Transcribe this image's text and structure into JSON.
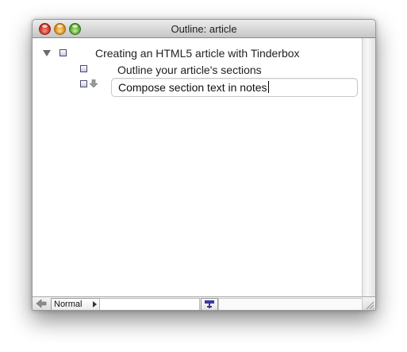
{
  "window": {
    "title": "Outline: article"
  },
  "outline": {
    "items": [
      {
        "label": "Creating an HTML5 article with Tinderbox",
        "level": 0,
        "expanded": true
      },
      {
        "label": "Outline your article's sections",
        "level": 1
      },
      {
        "label": "Compose section text in notes",
        "level": 1,
        "editing": true
      }
    ]
  },
  "statusbar": {
    "view_mode": "Normal"
  },
  "colors": {
    "close": "#c4261b",
    "minimize": "#d88a0f",
    "zoom": "#4c9d26",
    "note_icon": "#c9c9e6",
    "prototype_button": "#3a3a9a"
  }
}
